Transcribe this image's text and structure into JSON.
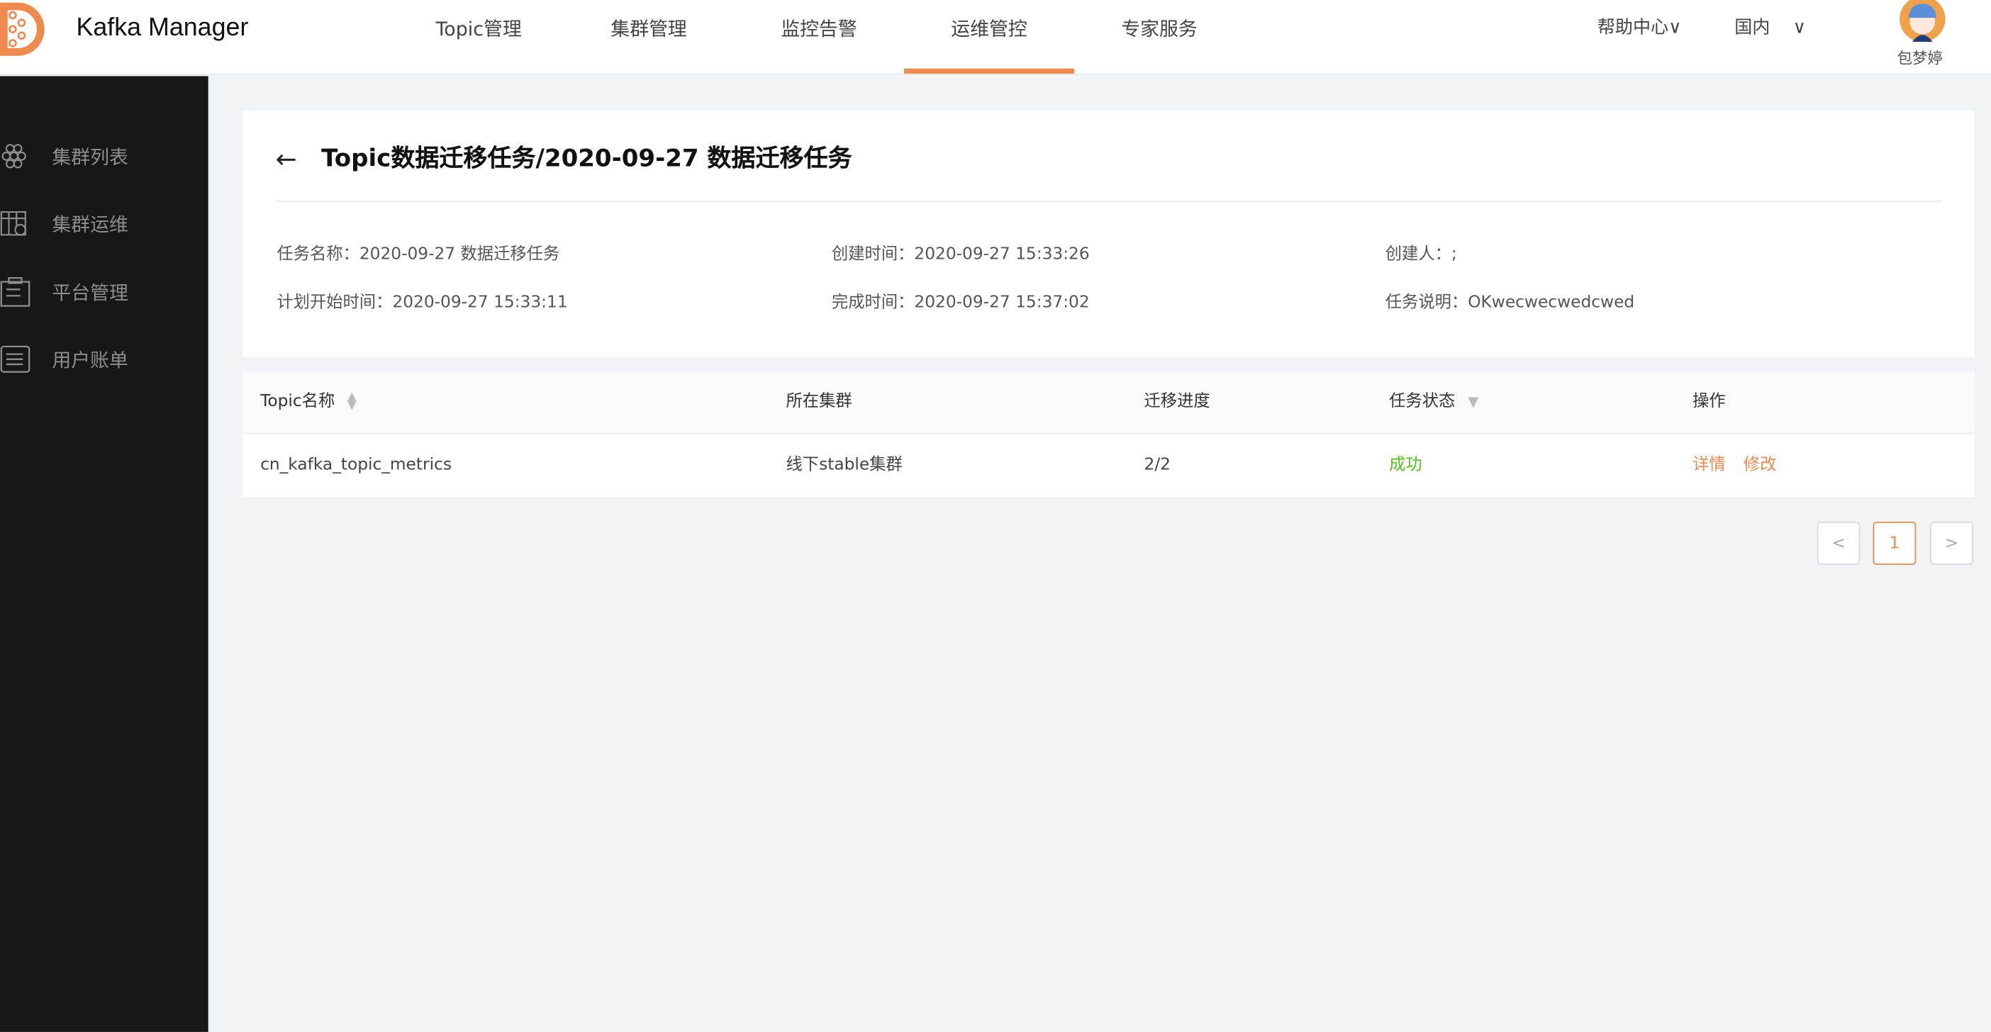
{
  "header": {
    "brand": "Kafka Manager",
    "nav": [
      {
        "label": "Topic管理"
      },
      {
        "label": "集群管理"
      },
      {
        "label": "监控告警"
      },
      {
        "label": "运维管控",
        "active": true
      },
      {
        "label": "专家服务"
      }
    ],
    "help": "帮助中心",
    "region": "国内",
    "user": "包梦婷",
    "accent": "#ef8a4f"
  },
  "sidebar": {
    "items": [
      {
        "label": "集群列表",
        "icon": "hexagon-grid-icon"
      },
      {
        "label": "集群运维",
        "icon": "table-dollar-icon"
      },
      {
        "label": "平台管理",
        "icon": "clipboard-icon"
      },
      {
        "label": "用户账单",
        "icon": "list-icon"
      }
    ]
  },
  "detail": {
    "title": "Topic数据迁移任务/2020-09-27 数据迁移任务",
    "fields": [
      {
        "label": "任务名称：",
        "value": "2020-09-27 数据迁移任务"
      },
      {
        "label": "创建时间：",
        "value": "2020-09-27 15:33:26"
      },
      {
        "label": "创建人：",
        "value": ";"
      },
      {
        "label": "计划开始时间：",
        "value": "2020-09-27 15:33:11"
      },
      {
        "label": "完成时间：",
        "value": "2020-09-27 15:37:02"
      },
      {
        "label": "任务说明：",
        "value": "OKwecwecwedcwed"
      }
    ]
  },
  "table": {
    "columns": [
      "Topic名称",
      "所在集群",
      "迁移进度",
      "任务状态",
      "操作"
    ],
    "rows": [
      {
        "topic": "cn_kafka_topic_metrics",
        "cluster": "线下stable集群",
        "progress": "2/2",
        "status": "成功",
        "actions": [
          "详情",
          "修改"
        ]
      }
    ],
    "status_color": "#52c41a"
  },
  "pagination": {
    "current": "1"
  }
}
